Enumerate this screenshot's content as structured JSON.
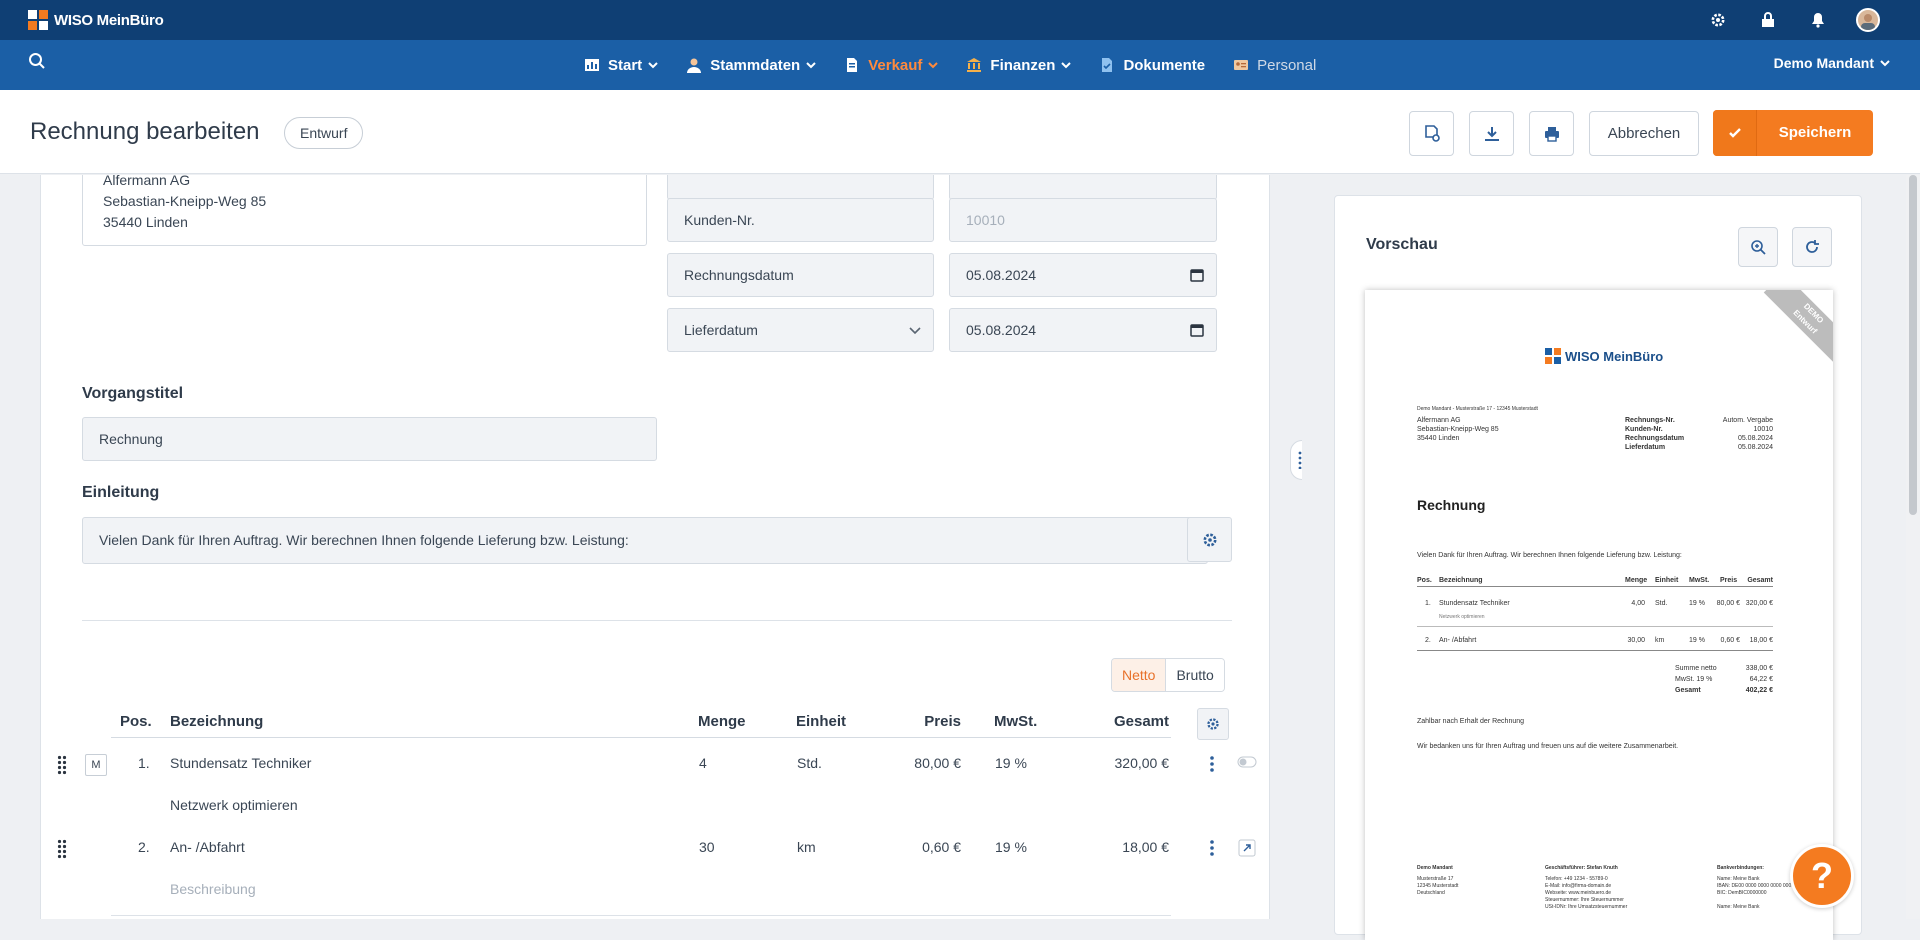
{
  "app": {
    "brand": "WISO MeinBüro"
  },
  "nav": {
    "items": [
      {
        "label": "Start",
        "icon": "chart-icon"
      },
      {
        "label": "Stammdaten",
        "icon": "person-icon"
      },
      {
        "label": "Verkauf",
        "icon": "document-icon",
        "active": true
      },
      {
        "label": "Finanzen",
        "icon": "bank-icon"
      },
      {
        "label": "Dokumente",
        "icon": "files-icon"
      },
      {
        "label": "Personal",
        "icon": "id-card-icon"
      }
    ],
    "mandant": "Demo Mandant"
  },
  "colors": {
    "topbar": "#0f3f74",
    "nav": "#1b5fa6",
    "accent": "#f47b20"
  },
  "header": {
    "title": "Rechnung bearbeiten",
    "status": "Entwurf",
    "cancel_label": "Abbrechen",
    "save_label": "Speichern"
  },
  "customer": {
    "address_lines": [
      "Alfermann AG",
      "Sebastian-Kneipp-Weg 85",
      "35440 Linden"
    ]
  },
  "fields": {
    "kunden_label": "Kunden-Nr.",
    "kunden_value": "10010",
    "rechnungsdatum_label": "Rechnungsdatum",
    "rechnungsdatum_value": "05.08.2024",
    "lieferdatum_label": "Lieferdatum",
    "lieferdatum_value": "05.08.2024"
  },
  "vorgangstitel": {
    "label": "Vorgangstitel",
    "value": "Rechnung"
  },
  "einleitung": {
    "label": "Einleitung",
    "value": "Vielen Dank für Ihren Auftrag. Wir berechnen Ihnen folgende Lieferung bzw. Leistung:"
  },
  "price_mode": {
    "netto": "Netto",
    "brutto": "Brutto",
    "selected": "Netto"
  },
  "table": {
    "headers": {
      "pos": "Pos.",
      "bezeichnung": "Bezeichnung",
      "menge": "Menge",
      "einheit": "Einheit",
      "preis": "Preis",
      "mwst": "MwSt.",
      "gesamt": "Gesamt"
    },
    "rows": [
      {
        "type": "M",
        "pos": "1.",
        "bezeichnung": "Stundensatz Techniker",
        "beschreibung": "Netzwerk optimieren",
        "menge": "4",
        "einheit": "Std.",
        "preis": "80,00 €",
        "mwst": "19 %",
        "gesamt": "320,00 €"
      },
      {
        "type": "",
        "pos": "2.",
        "bezeichnung": "An- /Abfahrt",
        "beschreibung": "Beschreibung",
        "menge": "30",
        "einheit": "km",
        "preis": "0,60 €",
        "mwst": "19 %",
        "gesamt": "18,00 €"
      }
    ]
  },
  "preview": {
    "title": "Vorschau",
    "ribbon": [
      "DEMO",
      "Entwurf"
    ],
    "sender_line": "Demo Mandant - Musterstraße 17 - 12345 Musterstadt",
    "recipient": [
      "Alfermann AG",
      "Sebastian-Kneipp-Weg 85",
      "35440 Linden"
    ],
    "meta": [
      {
        "k": "Rechnungs-Nr.",
        "v": "Autom. Vergabe"
      },
      {
        "k": "Kunden-Nr.",
        "v": "10010"
      },
      {
        "k": "Rechnungsdatum",
        "v": "05.08.2024"
      },
      {
        "k": "Lieferdatum",
        "v": "05.08.2024"
      }
    ],
    "doc_title": "Rechnung",
    "intro": "Vielen Dank für Ihren Auftrag. Wir berechnen Ihnen folgende Lieferung bzw. Leistung:",
    "headers": [
      "Pos.",
      "Bezeichnung",
      "Menge",
      "Einheit",
      "MwSt.",
      "Preis",
      "Gesamt"
    ],
    "rows": [
      {
        "pos": "1.",
        "bez": "Stundensatz Techniker",
        "sub": "Netzwerk optimieren",
        "menge": "4,00",
        "einheit": "Std.",
        "mwst": "19 %",
        "preis": "80,00 €",
        "gesamt": "320,00 €"
      },
      {
        "pos": "2.",
        "bez": "An- /Abfahrt",
        "sub": "",
        "menge": "30,00",
        "einheit": "km",
        "mwst": "19 %",
        "preis": "0,60 €",
        "gesamt": "18,00 €"
      }
    ],
    "totals": [
      {
        "k": "Summe netto",
        "v": "338,00 €"
      },
      {
        "k": "MwSt. 19 %",
        "v": "64,22 €"
      },
      {
        "k": "Gesamt",
        "v": "402,22 €"
      }
    ],
    "payment": "Zahlbar nach Erhalt der Rechnung",
    "closing": "Wir bedanken uns für Ihren Auftrag und freuen uns auf die weitere Zusammenarbeit.",
    "footer": {
      "col1": [
        "Demo Mandant",
        "Musterstraße 17",
        "12345 Musterstadt",
        "Deutschland"
      ],
      "col2": [
        "Geschäftsführer: Stefan Knuth",
        "Telefon: +49 1234 - 55789-0",
        "E-Mail: info@firma-domain.de",
        "Webseite: www.meinbuero.de",
        "Steuernummer: Ihre Steuernummer",
        "USt-IDNr: Ihre Umsatzsteuernummer"
      ],
      "col3": [
        "Bankverbindungen:",
        "Name: Meine Bank",
        "IBAN: DE00 0000 0000 0000 0000 00",
        "BIC: DemBIC0000000",
        "",
        "Name: Meine Bank"
      ]
    }
  },
  "help": "?"
}
